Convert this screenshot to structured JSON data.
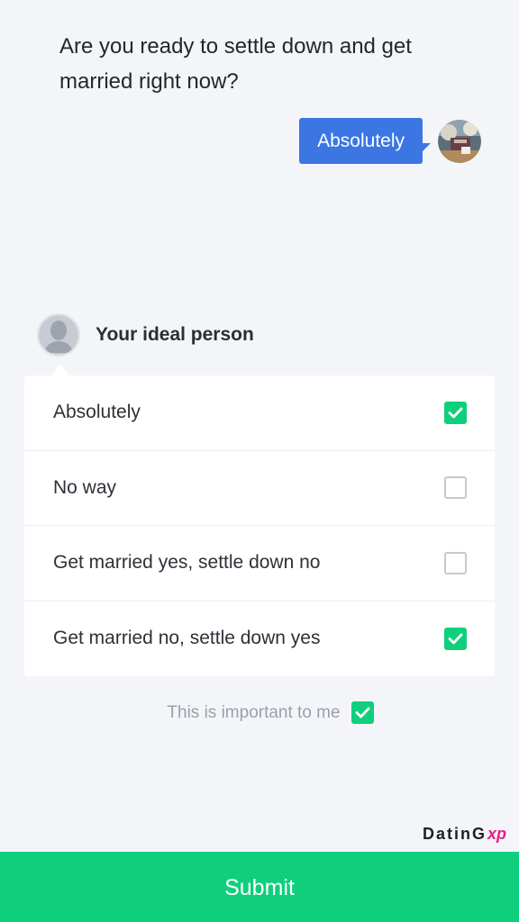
{
  "question": {
    "text": "Are you ready to settle down and get married right now?"
  },
  "my_answer": {
    "label": "Absolutely"
  },
  "ideal": {
    "title": "Your ideal person",
    "options": [
      {
        "label": "Absolutely",
        "checked": true
      },
      {
        "label": "No way",
        "checked": false
      },
      {
        "label": "Get married yes, settle down no",
        "checked": false
      },
      {
        "label": "Get married no, settle down yes",
        "checked": true
      }
    ]
  },
  "importance": {
    "label": "This is important to me",
    "checked": true
  },
  "brand": {
    "name_main": "DatinG",
    "name_accent": "xp"
  },
  "submit": {
    "label": "Submit"
  },
  "colors": {
    "accent_green": "#0fcf7c",
    "bubble_blue": "#3b76e3",
    "background": "#f4f5f9",
    "brand_pink": "#e5208a"
  },
  "icons": {
    "checkmark": "check-icon",
    "user_photo": "user-photo",
    "ideal_avatar": "person-silhouette-icon"
  }
}
